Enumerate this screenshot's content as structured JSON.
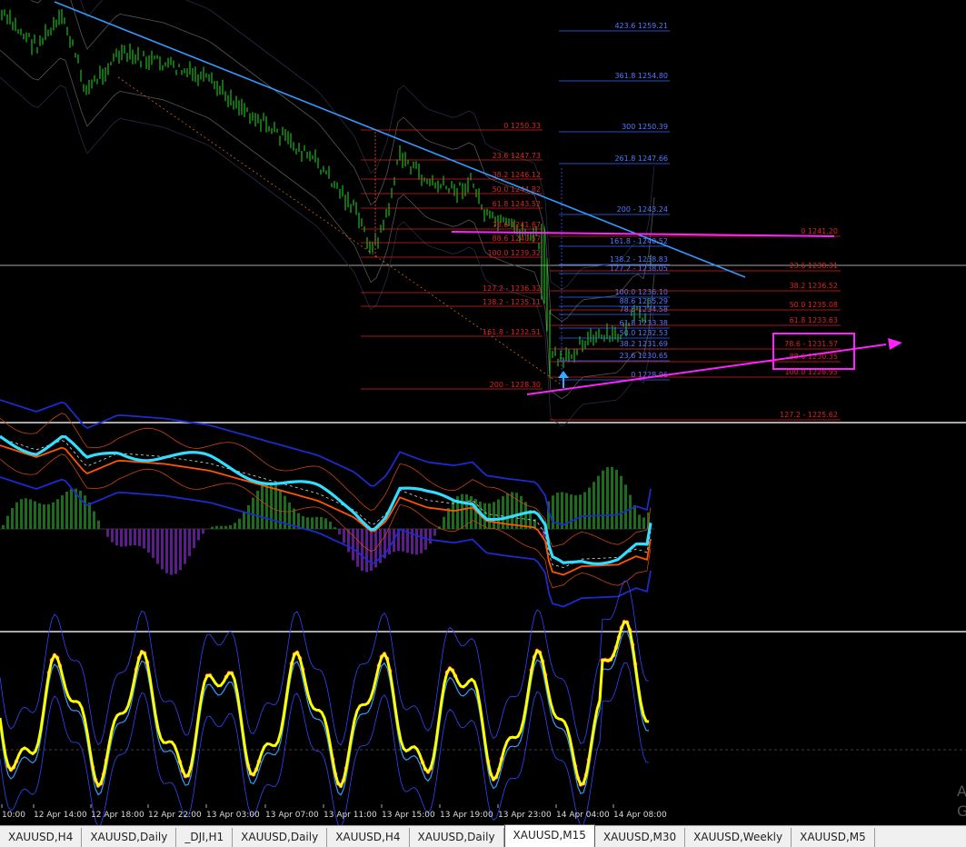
{
  "tabs": [
    {
      "label": "XAUUSD,H4",
      "active": false
    },
    {
      "label": "XAUUSD,Daily",
      "active": false
    },
    {
      "label": "_DJI,H1",
      "active": false
    },
    {
      "label": "XAUUSD,Daily",
      "active": false
    },
    {
      "label": "XAUUSD,H4",
      "active": false
    },
    {
      "label": "XAUUSD,Daily",
      "active": false
    },
    {
      "label": "XAUUSD,M15",
      "active": true
    },
    {
      "label": "XAUUSD,M30",
      "active": false
    },
    {
      "label": "XAUUSD,Weekly",
      "active": false
    },
    {
      "label": "XAUUSD,M5",
      "active": false
    }
  ],
  "time_axis": [
    "10:00",
    "12 Apr 14:00",
    "12 Apr 18:00",
    "12 Apr 22:00",
    "13 Apr 03:00",
    "13 Apr 07:00",
    "13 Apr 11:00",
    "13 Apr 15:00",
    "13 Apr 19:00",
    "13 Apr 23:00",
    "14 Apr 04:00",
    "14 Apr 08:00"
  ],
  "fib_red_left": [
    "0 1250.33",
    "23.6 1247.73",
    "38.2 1246.12",
    "50.0 1244.82",
    "61.8 1243.52",
    "78.6 1241.67",
    "88.6 1240.57",
    "100.0 1239.32",
    "127.2 - 1236.32",
    "138.2 - 1235.11",
    "161.8 - 1232.51",
    "200 - 1228.30"
  ],
  "fib_blue_upper": [
    "423.6 1259.21",
    "361.8 1254.80",
    "300 1250.39",
    "261.8 1247.66",
    "200 - 1243.24",
    "161.8 - 1240.52",
    "138.2 - 1238.83",
    "127.2 - 1238.05",
    "100.0 1236.10",
    "88.6 1235.29",
    "78.6 1234.58",
    "61.8 1233.38",
    "50.0 1232.53",
    "38.2 1231.69",
    "23.6 1230.65",
    "0 1228.96"
  ],
  "fib_red_right": [
    "0 1241.20",
    "23.6 1238.31",
    "38.2 1236.52",
    "50.0 1235.08",
    "61.8 1233.63",
    "78.6 - 1231.57",
    "88.6 1230.35",
    "100.0 1228.95",
    "127.2 - 1225.62"
  ],
  "colors": {
    "candle": "#22dd22",
    "trendline": "#3399ff",
    "magenta": "#ff22ff",
    "fib_red": "#dd2222",
    "fib_blue": "#3366ff",
    "cyan": "#33ddff",
    "orange": "#ff6600",
    "yellow": "#ffff00"
  },
  "watermark": "A\nG"
}
